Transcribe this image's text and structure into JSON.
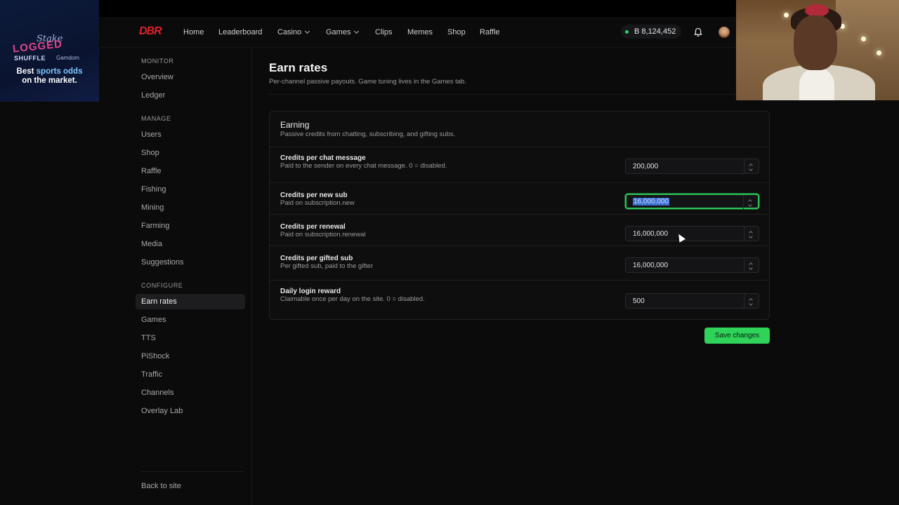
{
  "overlay_ad": {
    "brands": [
      "Stake",
      "LOGGED",
      "SHUFFLE",
      "Gamdom"
    ],
    "tagline_prefix": "Best ",
    "tagline_highlight": "sports odds",
    "tagline_suffix": "on the market."
  },
  "topnav": {
    "logo": "DBR",
    "items": [
      {
        "label": "Home",
        "has_menu": false
      },
      {
        "label": "Leaderboard",
        "has_menu": false
      },
      {
        "label": "Casino",
        "has_menu": true
      },
      {
        "label": "Games",
        "has_menu": true
      },
      {
        "label": "Clips",
        "has_menu": false
      },
      {
        "label": "Memes",
        "has_menu": false
      },
      {
        "label": "Shop",
        "has_menu": false
      },
      {
        "label": "Raffle",
        "has_menu": false
      }
    ],
    "balance": "B 8,124,452",
    "balance_status_color": "#29d75c",
    "bell_icon": "bell-icon",
    "avatar_icon": "user-avatar"
  },
  "sidebar": {
    "sections": [
      {
        "title": "MONITOR",
        "items": [
          "Overview",
          "Ledger"
        ]
      },
      {
        "title": "MANAGE",
        "items": [
          "Users",
          "Shop",
          "Raffle",
          "Fishing",
          "Mining",
          "Farming",
          "Media",
          "Suggestions"
        ]
      },
      {
        "title": "CONFIGURE",
        "items": [
          "Earn rates",
          "Games",
          "TTS",
          "PiShock",
          "Traffic",
          "Channels",
          "Overlay Lab"
        ]
      }
    ],
    "active_item": "Earn rates",
    "footer_link": "Back to site"
  },
  "page": {
    "title": "Earn rates",
    "subtitle": "Per-channel passive payouts. Game tuning lives in the Games tab."
  },
  "card": {
    "title": "Earning",
    "description": "Passive credits from chatting, subscribing, and gifting subs.",
    "rows": [
      {
        "label": "Credits per chat message",
        "description": "Paid to the sender on every chat message. 0 = disabled.",
        "value": "200,000",
        "focused": false
      },
      {
        "label": "Credits per new sub",
        "description": "Paid on subscription.new",
        "value": "16,000,000",
        "focused": true
      },
      {
        "label": "Credits per renewal",
        "description": "Paid on subscription.renewal",
        "value": "16,000,000",
        "focused": false
      },
      {
        "label": "Credits per gifted sub",
        "description": "Per gifted sub, paid to the gifter",
        "value": "16,000,000",
        "focused": false
      },
      {
        "label": "Daily login reward",
        "description": "Claimable once per day on the site. 0 = disabled.",
        "value": "500",
        "focused": false
      }
    ]
  },
  "actions": {
    "save_label": "Save changes",
    "accent_color": "#2fd35a"
  }
}
